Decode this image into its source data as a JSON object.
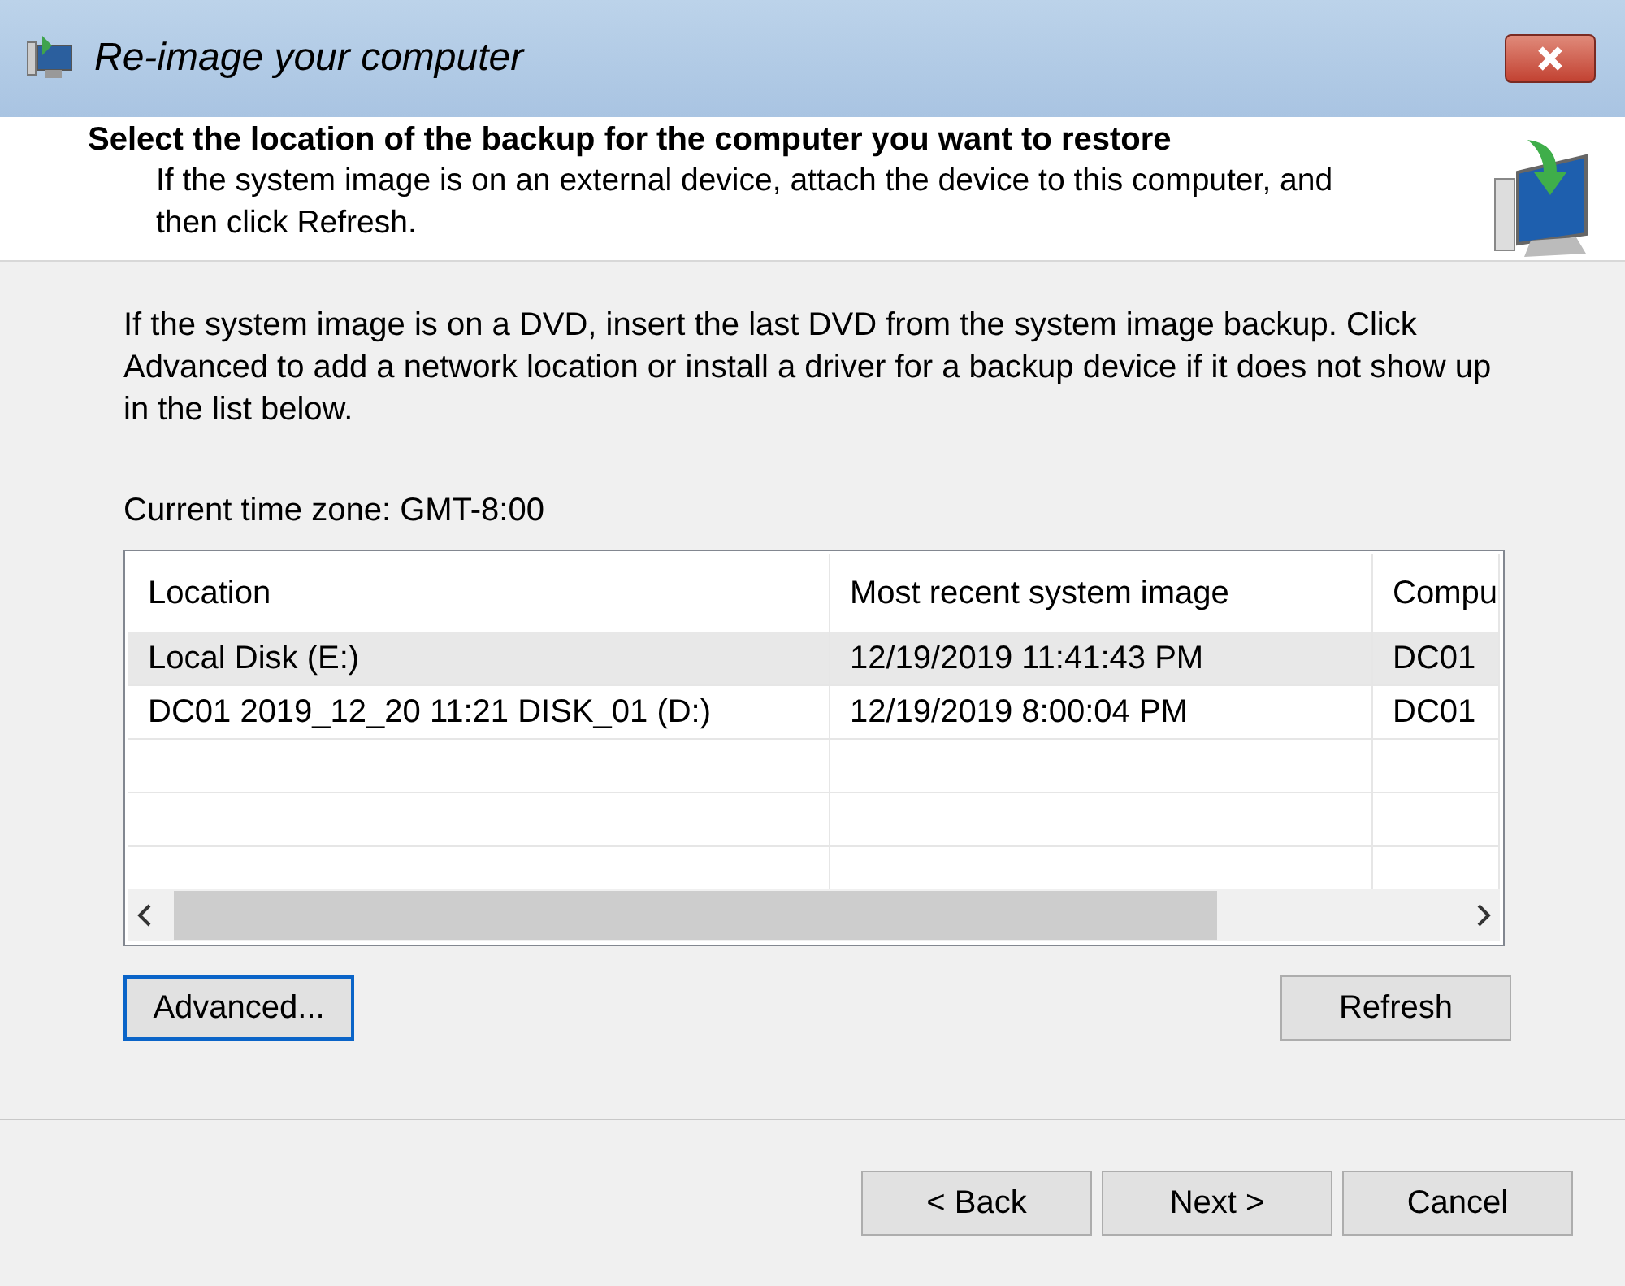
{
  "window": {
    "title": "Re-image your computer"
  },
  "header": {
    "title": "Select the location of the backup for the computer you want to restore",
    "subtitle": "If the system image is on an external device, attach the device to this computer, and then click Refresh."
  },
  "instructions": "If the system image is on a DVD, insert the last DVD from the system image backup. Click Advanced to add a network location or install a driver for a backup device if it does not show up in the list below.",
  "time_zone": "Current time zone: GMT-8:00",
  "table": {
    "columns": [
      "Location",
      "Most recent system image",
      "Compu"
    ],
    "rows": [
      {
        "cells": [
          "Local Disk (E:)",
          "12/19/2019 11:41:43 PM",
          "DC01"
        ],
        "selected": true
      },
      {
        "cells": [
          "DC01 2019_12_20 11:21 DISK_01 (D:)",
          "12/19/2019 8:00:04 PM",
          "DC01"
        ],
        "selected": false
      }
    ]
  },
  "list_buttons": [
    {
      "label": "Advanced...",
      "focused": true
    },
    {
      "label": "Refresh",
      "focused": false
    }
  ],
  "footer_buttons": [
    {
      "label": "< Back",
      "focused": false
    },
    {
      "label": "Next >",
      "focused": false
    },
    {
      "label": "Cancel",
      "focused": false
    }
  ]
}
